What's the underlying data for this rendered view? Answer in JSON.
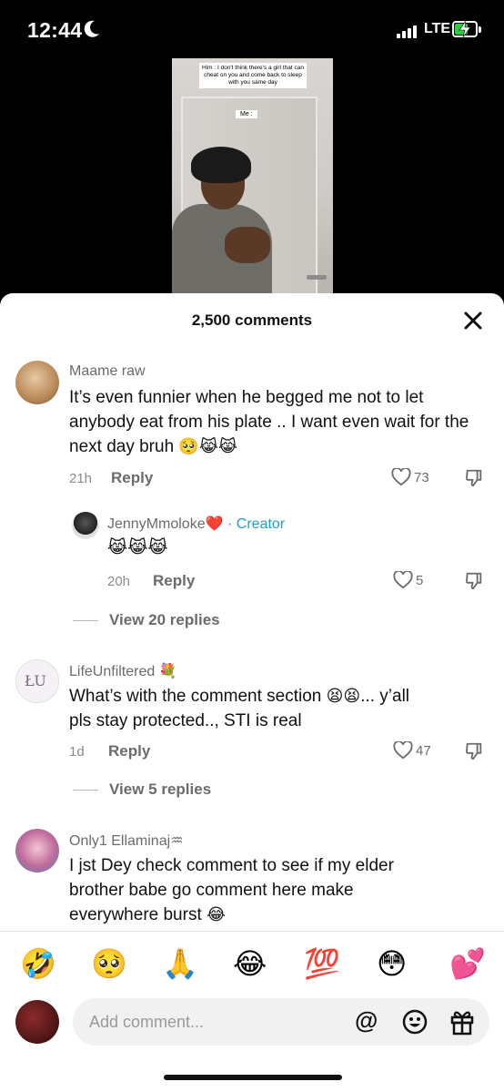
{
  "status_bar": {
    "time": "12:44",
    "network": "LTE"
  },
  "video": {
    "caption": "Him : I don't think there's a girl that can cheat on you and come back to sleep with you same day",
    "me_label": "Me :"
  },
  "sheet": {
    "count_label": "2,500 comments"
  },
  "comments": [
    {
      "username": "Maame raw",
      "text": "It’s even funnier when he begged me not to let anybody eat from his plate .. I want even wait for the next day bruh",
      "emojis": "🥺😹😹",
      "time": "21h",
      "reply_label": "Reply",
      "likes": "73"
    },
    {
      "username": "JennyMmoloke❤️",
      "creator_tag": "· Creator",
      "text": "",
      "emojis": "😹😹😹",
      "time": "20h",
      "reply_label": "Reply",
      "likes": "5"
    },
    {
      "view_replies": "View 20 replies"
    },
    {
      "username": "LifeUnfiltered 💐",
      "text_line1": "What’s with the comment section",
      "emojis": "😫😫",
      "text_line1_tail": "... y’all",
      "text_line2": "pls stay protected.., STI is real",
      "time": "1d",
      "reply_label": "Reply",
      "likes": "47"
    },
    {
      "view_replies": "View 5 replies"
    },
    {
      "username": "Only1  Ellaminaj♒",
      "text": "I jst Dey check comment to see if my elder brother babe go comment here make everywhere burst",
      "emojis": "😂"
    }
  ],
  "quick_emojis": [
    "🤣",
    "🥺",
    "🙏",
    "😂",
    "💯",
    "😳",
    "💕"
  ],
  "input": {
    "placeholder": "Add comment...",
    "at_symbol": "@"
  },
  "icons": {
    "moon": "moon-icon",
    "close": "close-icon",
    "heart": "heart-outline-icon",
    "dislike": "thumbs-down-icon",
    "smile": "emoji-icon",
    "gift": "gift-icon"
  }
}
